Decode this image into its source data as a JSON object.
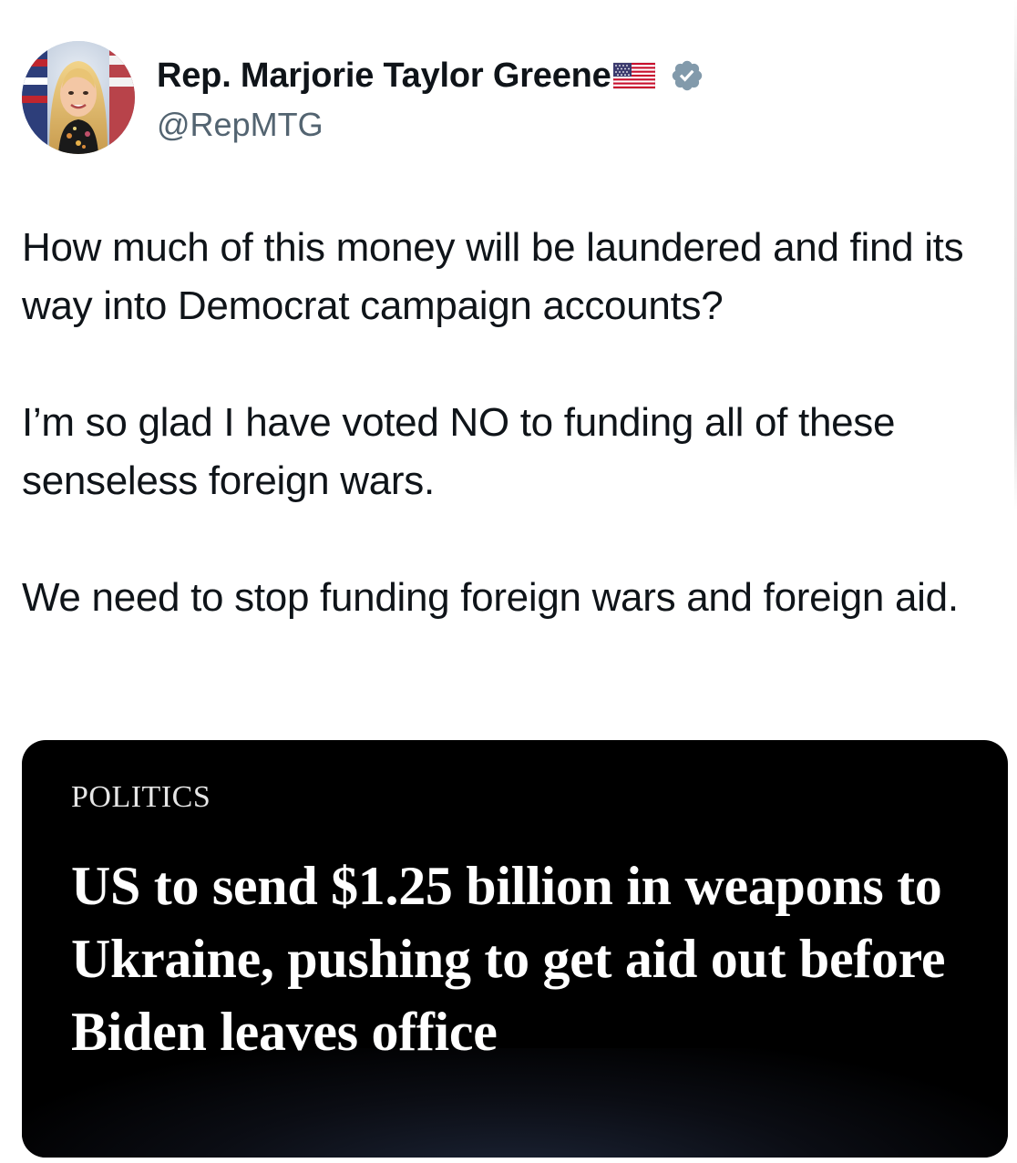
{
  "author": {
    "display_name": "Rep. Marjorie Taylor Greene",
    "handle": "@RepMTG",
    "name_emoji": "us-flag-icon",
    "verified_badge": "verified-icon",
    "verified_color": "#829aab"
  },
  "tweet": {
    "paragraphs": [
      "How much of this money will be laundered and find its way into Democrat campaign accounts?",
      "I’m so glad I have voted NO to funding all of these senseless foreign wars.",
      "We need to stop funding foreign wars and foreign aid."
    ]
  },
  "link_card": {
    "category": "POLITICS",
    "headline": "US to send $1.25 billion in weapons to Ukraine, pushing to get aid out before Biden leaves office",
    "background": "#000000"
  }
}
